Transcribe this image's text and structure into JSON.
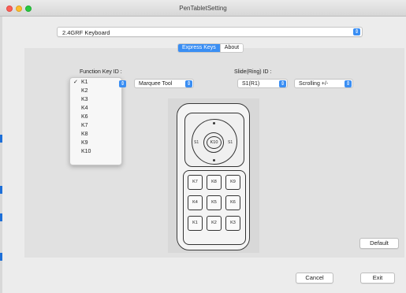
{
  "window": {
    "title": "PenTabletSetting"
  },
  "device": {
    "selected": "2.4GRF Keyboard",
    "stepper_icon": "up-down-chevron-icon"
  },
  "tabs": [
    {
      "label": "Express Keys",
      "active": true
    },
    {
      "label": "About",
      "active": false
    }
  ],
  "function_key": {
    "label": "Function Key ID :",
    "selected": "K1",
    "options": [
      "K1",
      "K2",
      "K3",
      "K4",
      "K6",
      "K7",
      "K8",
      "K9",
      "K10"
    ],
    "action": "Marquee Tool"
  },
  "slide_ring": {
    "label": "Slide(Ring) ID :",
    "selected": "S1(R1)",
    "action": "Scrolling +/-"
  },
  "remote": {
    "ring_key": "K10",
    "left_label": "S1",
    "right_label": "S1",
    "keys": [
      "K7",
      "K8",
      "K9",
      "K4",
      "K5",
      "K6",
      "K1",
      "K2",
      "K3"
    ]
  },
  "buttons": {
    "default": "Default",
    "cancel": "Cancel",
    "exit": "Exit"
  },
  "colors": {
    "accent": "#3a8ef3",
    "panel": "#e1e1e1",
    "window": "#ececec"
  }
}
